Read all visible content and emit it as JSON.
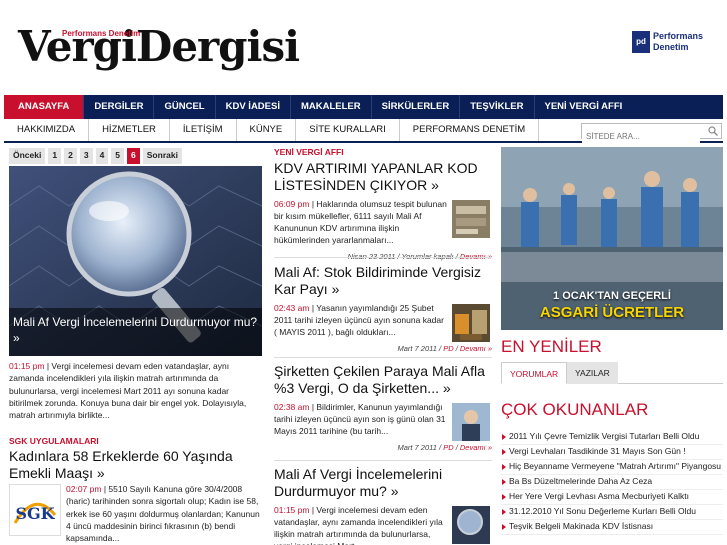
{
  "header": {
    "logo_text": "VergiDergisi",
    "logo_subtext": "Performans Denetim",
    "partner_logo_box": "pd",
    "partner_logo_line1": "Performans",
    "partner_logo_line2": "Denetim"
  },
  "nav_primary": [
    "ANASAYFA",
    "DERGİLER",
    "GÜNCEL",
    "KDV İADESİ",
    "MAKALELER",
    "SİRKÜLERLER",
    "TEŞVİKLER",
    "YENİ VERGİ AFFI"
  ],
  "nav_secondary": [
    "HAKKIMIZDA",
    "HİZMETLER",
    "İLETİŞİM",
    "KÜNYE",
    "SİTE KURALLARI",
    "PERFORMANS DENETİM"
  ],
  "search": {
    "placeholder": "SİTEDE ARA..."
  },
  "pager": {
    "prev": "Önceki",
    "pages": [
      "1",
      "2",
      "3",
      "4",
      "5",
      "6"
    ],
    "current": "6",
    "next": "Sonraki"
  },
  "featured": {
    "caption": "Mali Af Vergi İncelemelerini Durdurmuyor mu? »",
    "time": "01:15 pm",
    "text": "Vergi incelemesi devam eden vatandaşlar, aynı zamanda incelendikleri yıla ilişkin matrah artırımında da bulunurlarsa, vergi incelemesi Mart 2011 ayı sonuna kadar bitirilmek zorunda. Konuya buna dair bir engel yok. Dolayısıyla, matrah artırımıyla birlikte..."
  },
  "sgk": {
    "category": "SGK UYGULAMALARI",
    "title": "Kadınlara 58 Erkeklerde 60 Yaşında Emekli Maaşı »",
    "time": "02:07 pm",
    "text": "5510 Sayılı Kanuna göre 30/4/2008 (haric) tarihinden sonra sigortalı olup; Kadın ise 58, erkek ise 60 yaşını doldurmuş olanlardan; Kanunun 4 üncü maddesinin birinci fıkrasının (b) bendi kapsamında...",
    "logo_text": "SGK"
  },
  "middle": {
    "category": "YENİ VERGİ AFFI",
    "articles": [
      {
        "title": "KDV ARTIRIMI YAPANLAR KOD LİSTESİNDEN ÇIKIYOR »",
        "time": "06:09 pm",
        "text": "Haklarında olumsuz tespit bulunan bir kısım mükellefler, 6111 sayılı Mali Af Kanununun KDV artırımına ilişkin hükümlerinden yararlanmaları...",
        "meta": "Nisan 23 2011 / Yorumlar kapalı /",
        "more": "Devamı »"
      },
      {
        "title": "Mali Af: Stok Bildiriminde Vergisiz Kar Payı »",
        "time": "02:43 am",
        "text": "Yasanın yayımlandığı 25 Şubet 2011 tarihi izleyen üçüncü ayın sonuna kadar ( MAYIS 2011 ), bağlı oldukları...",
        "meta": "Mart 7 2011 /",
        "reply": "PD",
        "more": "Devamı »"
      },
      {
        "title": "Şirketten Çekilen Paraya Mali Afla %3 Vergi, O da Şirketten... »",
        "time": "02:38 am",
        "text": "Bildirimler, Kanunun yayımlandığı tarihi izleyen üçüncü ayın son iş günü olan 31 Mayıs 2011 tarihine (bu tarih...",
        "meta": "Mart 7 2011 /",
        "reply": "PD",
        "more": "Devamı »"
      },
      {
        "title": "Mali Af Vergi İncelemelerini Durdurmuyor mu? »",
        "time": "01:15 pm",
        "text": "Vergi incelemesi devam eden vatandaşlar, aynı zamanda incelendikleri yıla ilişkin matrah artırımında da bulunurlarsa, vergi incelemesi Mart..."
      }
    ]
  },
  "ad": {
    "line1": "1 OCAK'TAN GEÇERLİ",
    "line2": "ASGARİ ÜCRETLER"
  },
  "sidebar": {
    "latest_title": "EN YENİLER",
    "tabs": [
      "YORUMLAR",
      "YAZILAR"
    ],
    "popular_title": "ÇOK OKUNANLAR",
    "popular": [
      "2011 Yılı Çevre Temizlik Vergisi Tutarları Belli Oldu",
      "Vergi Levhaları Tasdikinde 31 Mayıs Son Gün !",
      "Hiç Beyanname Vermeyene \"Matrah Artırımı\" Piyangosu",
      "Ba Bs Düzeltmelerinde Daha Az Ceza",
      "Her Yere Vergi Levhası Asma Mecburiyeti Kalktı",
      "31.12.2010 Yıl Sonu Değerleme Kurları Belli Oldu",
      "Teşvik Belgeli Makinada KDV İstisnası"
    ]
  },
  "colors": {
    "brand_red": "#c8102e",
    "nav_navy": "#0a1f55",
    "ad_yellow": "#f6d500"
  }
}
